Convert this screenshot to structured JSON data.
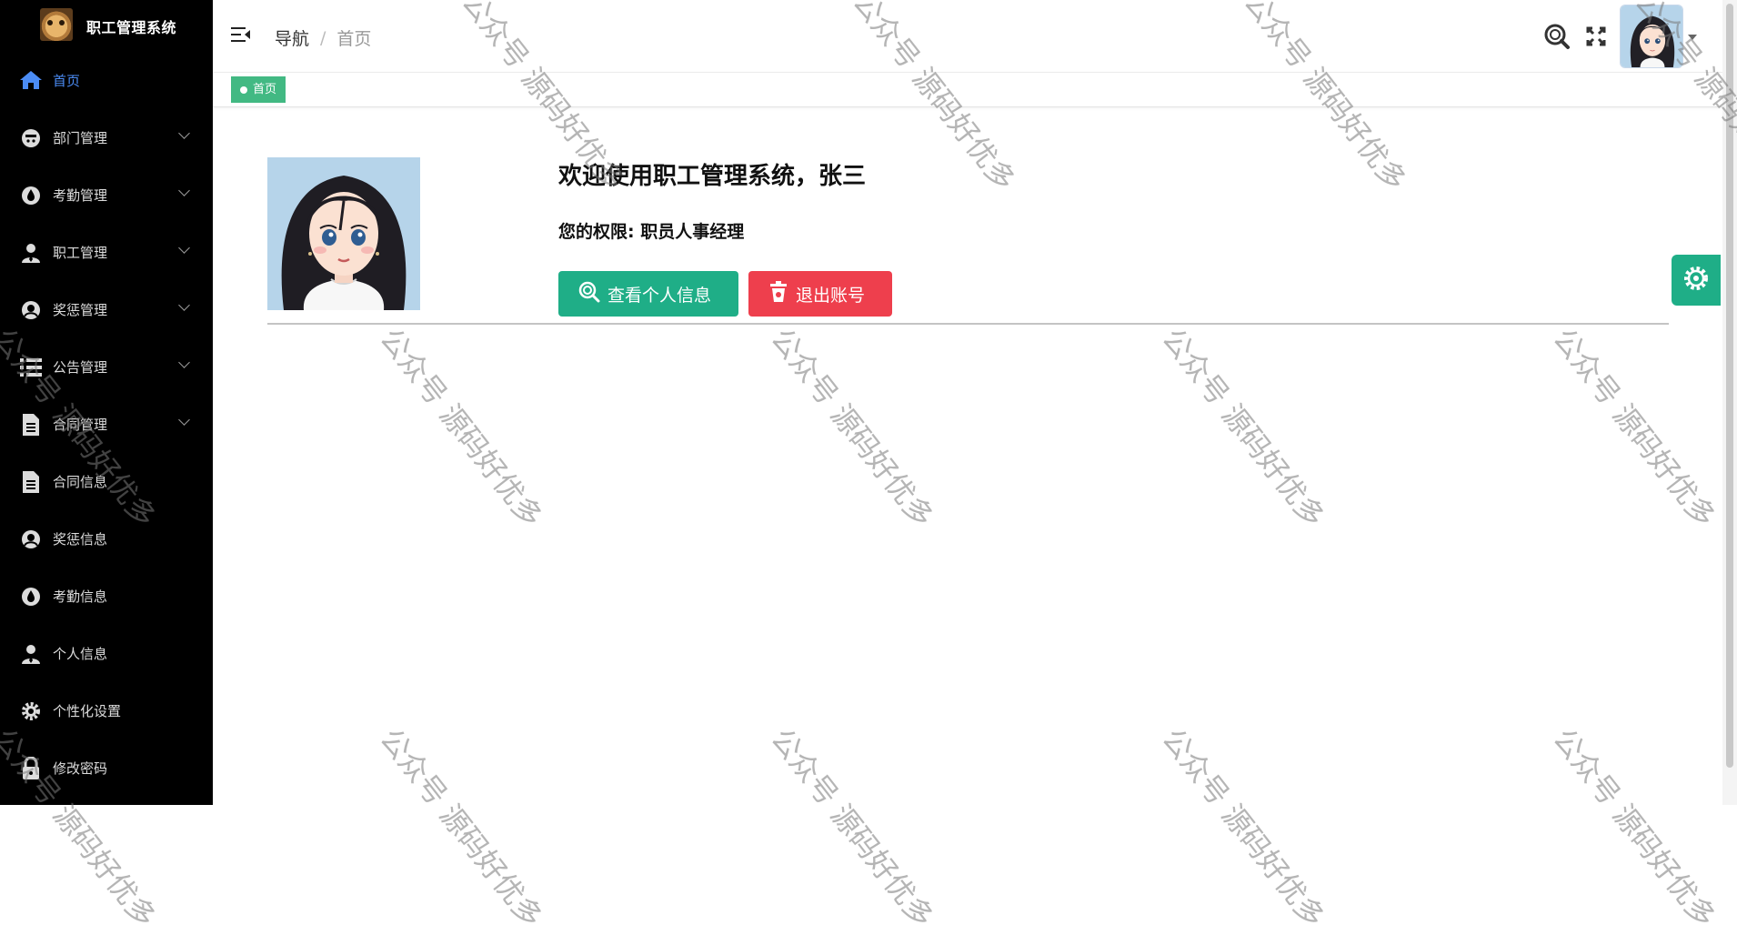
{
  "app": {
    "title": "职工管理系统"
  },
  "sidebar": {
    "items": [
      {
        "label": "首页",
        "icon": "home-icon",
        "active": true,
        "expandable": false
      },
      {
        "label": "部门管理",
        "icon": "department-icon",
        "expandable": true
      },
      {
        "label": "考勤管理",
        "icon": "attendance-icon",
        "expandable": true
      },
      {
        "label": "职工管理",
        "icon": "staff-icon",
        "expandable": true
      },
      {
        "label": "奖惩管理",
        "icon": "reward-icon",
        "expandable": true
      },
      {
        "label": "公告管理",
        "icon": "notice-icon",
        "expandable": true
      },
      {
        "label": "合同管理",
        "icon": "contract-icon",
        "expandable": true
      },
      {
        "label": "合同信息",
        "icon": "contract-info-icon",
        "expandable": false
      },
      {
        "label": "奖惩信息",
        "icon": "reward-info-icon",
        "expandable": false
      },
      {
        "label": "考勤信息",
        "icon": "attendance-info-icon",
        "expandable": false
      },
      {
        "label": "个人信息",
        "icon": "person-icon",
        "expandable": false
      },
      {
        "label": "个性化设置",
        "icon": "gear-icon",
        "expandable": false
      },
      {
        "label": "修改密码",
        "icon": "lock-icon",
        "expandable": false
      }
    ]
  },
  "header": {
    "breadcrumb": {
      "nav": "导航",
      "sep": "/",
      "current": "首页"
    }
  },
  "tags": {
    "active": "首页"
  },
  "main": {
    "welcome": "欢迎使用职工管理系统，张三",
    "role": "您的权限: 职员人事经理",
    "btn_profile": "查看个人信息",
    "btn_logout": "退出账号"
  },
  "watermark": {
    "text": "公众号 源码好优多"
  },
  "colors": {
    "sidebar_bg": "#000000",
    "active_menu": "#4b8cf5",
    "tag_green": "#42b983",
    "btn_green": "#1fae87",
    "btn_red": "#ee3f4d"
  }
}
